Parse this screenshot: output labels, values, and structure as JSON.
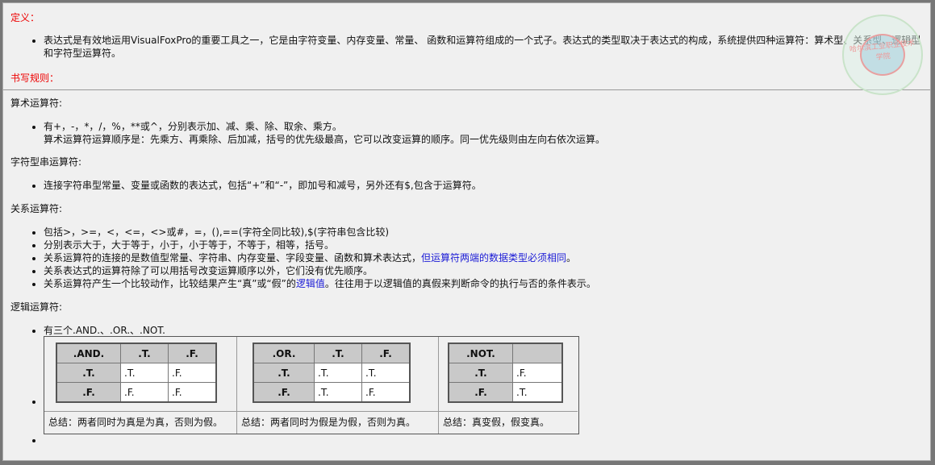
{
  "definition": {
    "title": "定义：",
    "text": "表达式是有效地运用VisualFoxPro的重要工具之一，它是由字符变量、内存变量、常量、 函数和运算符组成的一个式子。表达式的类型取决于表达式的构成，系统提供四种运算符：算术型、关系型、逻辑型",
    "text2": "和字符型运算符。"
  },
  "rules_title": "书写规则：",
  "arith": {
    "title": "算术运算符:",
    "line1": "有+，-，*，/，%，**或^，分别表示加、减、乘、除、取余、乘方。",
    "line2": "算术运算符运算顺序是：先乘方、再乘除、后加减，括号的优先级最高，它可以改变运算的顺序。同一优先级则由左向右依次运算。"
  },
  "string": {
    "title": "字符型串运算符:",
    "line1": "连接字符串型常量、变量或函数的表达式，包括“+”和“-”，即加号和减号，另外还有$,包含于运算符。"
  },
  "relation": {
    "title": "关系运算符:",
    "items": [
      "包括>，>=，<，<=，<>或#，=，(),==(字符全同比较),$(字符串包含比较)",
      "分别表示大于，大于等于，小于，小于等于，不等于，相等，括号。",
      "关系运算符的连接的是数值型常量、字符串、内存变量、字段变量、函数和算术表达式，",
      "关系表达式的运算符除了可以用括号改变运算顺序以外，它们没有优先顺序。",
      "关系运算符产生一个比较动作，比较结果产生“真”或“假”的"
    ],
    "blue3": "但运算符两端的数据类型必须相同",
    "tail3": "。",
    "blue5": "逻辑值",
    "tail5": "。往往用于以逻辑值的真假来判断命令的执行与否的条件表示。"
  },
  "logic": {
    "title": "逻辑运算符:",
    "intro": "有三个.AND.、.OR.、.NOT.",
    "and_table": [
      [
        ".AND.",
        ".T.",
        ".F."
      ],
      [
        ".T.",
        ".T.",
        ".F."
      ],
      [
        ".F.",
        ".F.",
        ".F."
      ]
    ],
    "or_table": [
      [
        ".OR.",
        ".T.",
        ".F."
      ],
      [
        ".T.",
        ".T.",
        ".T."
      ],
      [
        ".F.",
        ".T.",
        ".F."
      ]
    ],
    "not_table": [
      [
        ".NOT.",
        ""
      ],
      [
        ".T.",
        ".F."
      ],
      [
        ".F.",
        ".T."
      ]
    ],
    "summary_and": "总结：两者同时为真是为真，否则为假。",
    "summary_or": "总结：两者同时为假是为假，否则为真。",
    "summary_not": "总结：真变假，假变真。"
  },
  "seal_text": "哈尔滨工业职业技术学院"
}
